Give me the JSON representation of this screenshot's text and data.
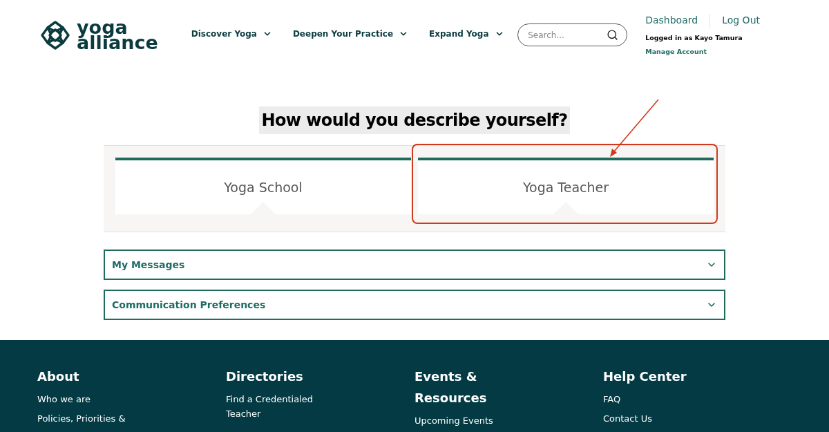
{
  "header": {
    "logo": {
      "line1": "yoga",
      "line2": "alliance"
    },
    "nav": [
      {
        "label": "Discover Yoga"
      },
      {
        "label": "Deepen Your Practice"
      },
      {
        "label": "Expand Yoga"
      }
    ],
    "search": {
      "placeholder": "Search..."
    },
    "account": {
      "links": [
        "Dashboard",
        "Log Out"
      ],
      "logged_in": "Logged in as Kayo Tamura",
      "manage": "Manage Account"
    }
  },
  "heading": "How would you describe yourself?",
  "tabs": [
    {
      "label": "Yoga School",
      "highlighted": false
    },
    {
      "label": "Yoga Teacher",
      "highlighted": true
    }
  ],
  "accordions": [
    {
      "label": "My Messages",
      "expanded": false
    },
    {
      "label": "Communication Preferences",
      "expanded": false
    }
  ],
  "footer": {
    "columns": [
      {
        "title": "About",
        "links": [
          "Who we are",
          "Policies, Priorities &"
        ]
      },
      {
        "title": "Directories",
        "links": [
          "Find a Credentialed Teacher"
        ]
      },
      {
        "title": "Events & Resources",
        "links": [
          "Upcoming Events"
        ]
      },
      {
        "title": "Help Center",
        "links": [
          "FAQ",
          "Contact Us"
        ]
      }
    ]
  }
}
